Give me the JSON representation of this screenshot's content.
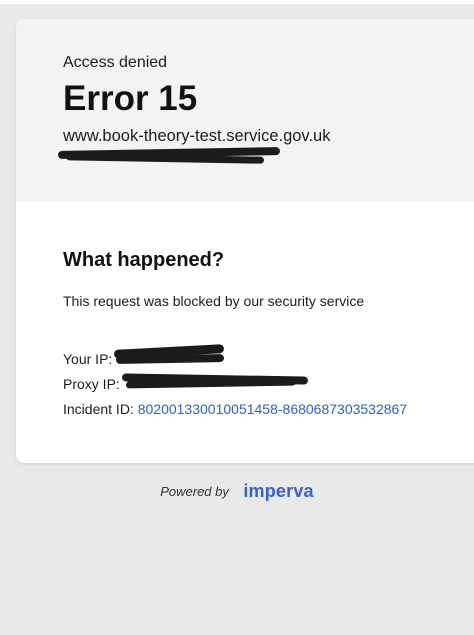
{
  "header": {
    "status_text": "Access denied",
    "error_code": "Error 15",
    "domain": "www.book-theory-test.service.gov.uk"
  },
  "main": {
    "title": "What happened?",
    "description": "This request was blocked by our security service",
    "your_ip_label": "Your IP:",
    "proxy_ip_label": "Proxy IP:",
    "incident_label": "Incident ID:",
    "incident_id": "802001330010051458-8680687303532867"
  },
  "footer": {
    "powered_by": "Powered by",
    "brand": "imperva"
  },
  "colors": {
    "link": "#2a62c9",
    "brand": "#3162d6",
    "header_bg": "#f3f3f3",
    "page_bg": "#e9e9ea"
  }
}
